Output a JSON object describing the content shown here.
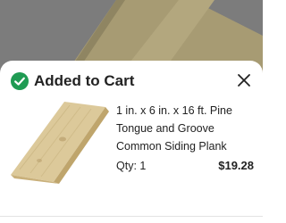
{
  "modal": {
    "title": "Added to Cart",
    "close_icon": "close-icon",
    "status_icon": "check-circle-icon",
    "accent_color": "#1f9b53"
  },
  "item": {
    "name": "1 in. x 6 in. x 16 ft. Pine Tongue and Groove Common Siding Plank",
    "qty_label": "Qty:",
    "qty_value": "1",
    "price": "$19.28",
    "image_icon": "wood-plank-image"
  }
}
